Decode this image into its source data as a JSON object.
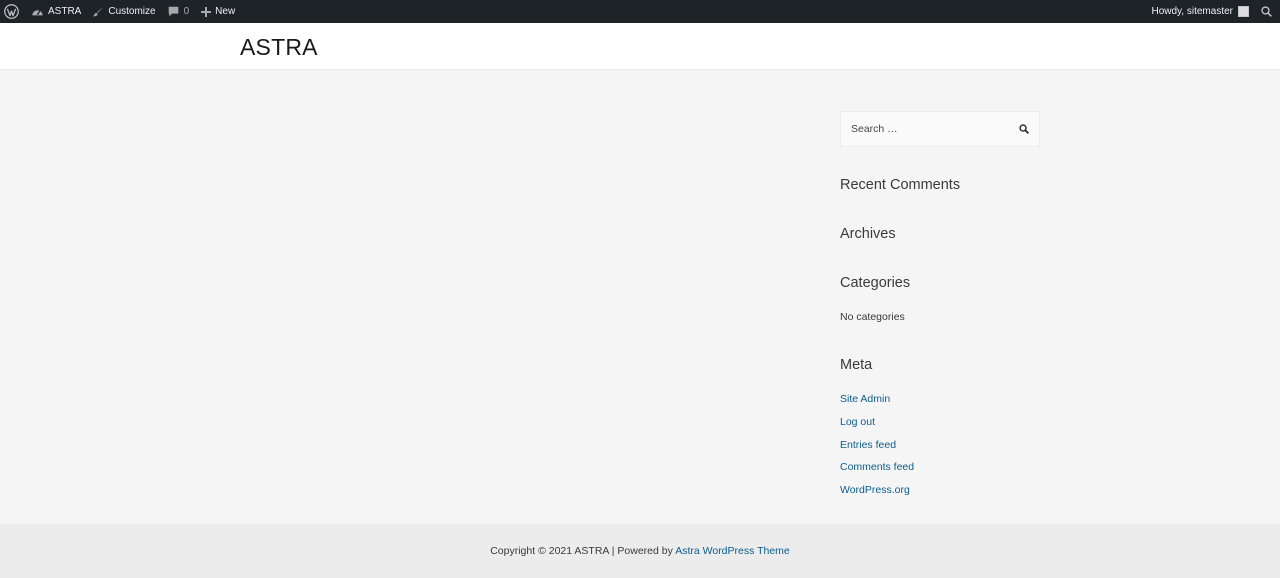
{
  "admin_bar": {
    "site_name": "ASTRA",
    "customize_label": "Customize",
    "comments_count": "0",
    "new_label": "New",
    "greeting": "Howdy, sitemaster"
  },
  "header": {
    "site_title": "ASTRA"
  },
  "sidebar": {
    "search_placeholder": "Search …",
    "recent_comments_title": "Recent Comments",
    "archives_title": "Archives",
    "categories_title": "Categories",
    "no_categories": "No categories",
    "meta_title": "Meta",
    "meta_links": [
      "Site Admin",
      "Log out",
      "Entries feed",
      "Comments feed",
      "WordPress.org"
    ]
  },
  "footer": {
    "copyright": "Copyright © 2021 ASTRA | Powered by ",
    "theme_link": "Astra WordPress Theme"
  }
}
